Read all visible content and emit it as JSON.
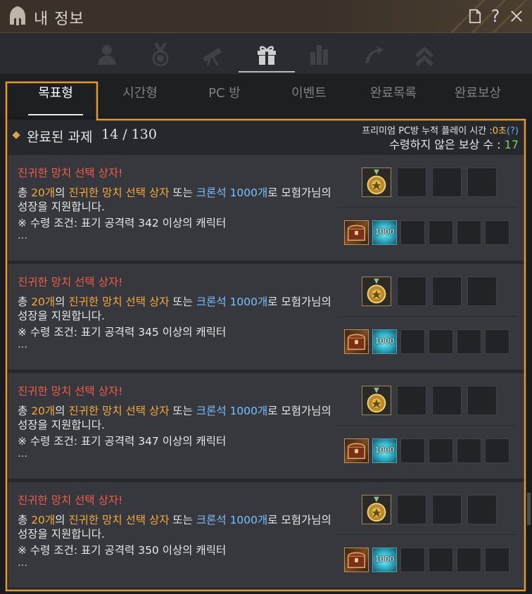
{
  "window": {
    "title": "내 정보",
    "icons": [
      "helmet-icon",
      "document-icon",
      "help-icon",
      "close-icon"
    ]
  },
  "icon_tabs": [
    {
      "name": "profile",
      "icon": "person-icon",
      "active": false
    },
    {
      "name": "medal",
      "icon": "medal-icon",
      "active": false
    },
    {
      "name": "telescope",
      "icon": "telescope-icon",
      "active": false
    },
    {
      "name": "gift",
      "icon": "gift-icon",
      "active": true
    },
    {
      "name": "stats",
      "icon": "bar-chart-icon",
      "active": false
    },
    {
      "name": "growth",
      "icon": "growth-icon",
      "active": false
    },
    {
      "name": "rank",
      "icon": "chevron-up-icon",
      "active": false
    }
  ],
  "tabs": [
    {
      "label": "목표형",
      "active": true
    },
    {
      "label": "시간형",
      "active": false
    },
    {
      "label": "PC 방",
      "active": false
    },
    {
      "label": "이벤트",
      "active": false
    },
    {
      "label": "완료목록",
      "active": false
    },
    {
      "label": "완료보상",
      "active": false
    }
  ],
  "header": {
    "completed_label": "완료된 과제",
    "completed_count": "14 / 130",
    "pc_time_label": "프리미엄 PC방 누적 플레이 시간 :",
    "pc_time_value": "0초",
    "pc_help": "(?)",
    "unclaimed_label": "수령하지 않은 보상 수 :",
    "unclaimed_value": "17"
  },
  "cards": [
    {
      "title": "진귀한 망치 선택 상자!",
      "d_total": "총 ",
      "d_count": "20개",
      "d_of": "의 ",
      "d_item": "진귀한 망치 선택 상자",
      "d_or": " 또는 ",
      "d_stone": "크론석 1000개",
      "d_tail": "로 모험가님의 성장을 지원합니다.",
      "cond_label": "※ 수령 조건:",
      "cond_pre": " 표기 공격력 ",
      "cond_value": "342",
      "cond_post": " 이상의 캐릭터",
      "more": "…",
      "reward_medal": "medal-icon",
      "reward_box": "chest-icon",
      "crystal_label": "1000"
    },
    {
      "title": "진귀한 망치 선택 상자!",
      "d_total": "총 ",
      "d_count": "20개",
      "d_of": "의 ",
      "d_item": "진귀한 망치 선택 상자",
      "d_or": " 또는 ",
      "d_stone": "크론석 1000개",
      "d_tail": "로 모험가님의 성장을 지원합니다.",
      "cond_label": "※ 수령 조건:",
      "cond_pre": " 표기 공격력 ",
      "cond_value": "345",
      "cond_post": " 이상의 캐릭터",
      "more": "…",
      "reward_medal": "medal-icon",
      "reward_box": "chest-icon",
      "crystal_label": "1000"
    },
    {
      "title": "진귀한 망치 선택 상자!",
      "d_total": "총 ",
      "d_count": "20개",
      "d_of": "의 ",
      "d_item": "진귀한 망치 선택 상자",
      "d_or": " 또는 ",
      "d_stone": "크론석 1000개",
      "d_tail": "로 모험가님의 성장을 지원합니다.",
      "cond_label": "※ 수령 조건:",
      "cond_pre": " 표기 공격력 ",
      "cond_value": "347",
      "cond_post": " 이상의 캐릭터",
      "more": "…",
      "reward_medal": "medal-icon",
      "reward_box": "chest-icon",
      "crystal_label": "1000"
    },
    {
      "title": "진귀한 망치 선택 상자!",
      "d_total": "총 ",
      "d_count": "20개",
      "d_of": "의 ",
      "d_item": "진귀한 망치 선택 상자",
      "d_or": " 또는 ",
      "d_stone": "크론석 1000개",
      "d_tail": "로 모험가님의 성장을 지원합니다.",
      "cond_label": "※ 수령 조건:",
      "cond_pre": " 표기 공격력 ",
      "cond_value": "350",
      "cond_post": " 이상의 캐릭터",
      "more": "…",
      "reward_medal": "medal-icon",
      "reward_box": "chest-icon",
      "crystal_label": "1000"
    }
  ],
  "colors": {
    "accent_orange": "#e39a2c",
    "title_red": "#ee5d45",
    "highlight_blue": "#79c1ff",
    "condition_green": "#7ad23f",
    "value_yellow": "#f2c84a"
  }
}
